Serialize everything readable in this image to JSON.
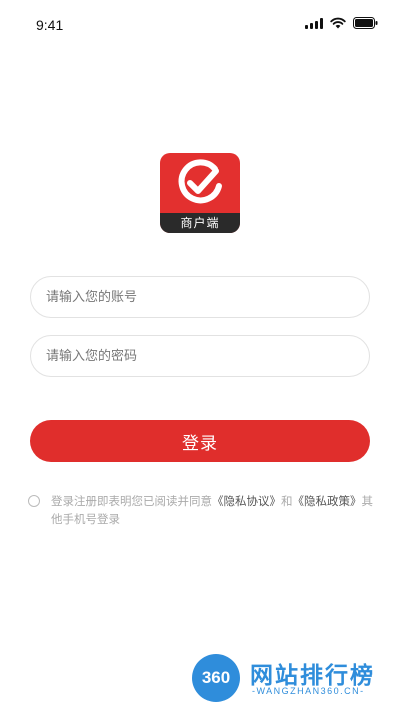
{
  "status_bar": {
    "time": "9:41"
  },
  "logo": {
    "label": "商户端"
  },
  "form": {
    "account_placeholder": "请输入您的账号",
    "password_placeholder": "请输入您的密码",
    "login_label": "登录"
  },
  "agreement": {
    "prefix": "登录注册即表明您已阅读并同意",
    "privacy_agreement": "《隐私协议》",
    "and": "和",
    "privacy_policy": "《隐私政策》",
    "other_login": "其他手机号登录"
  },
  "watermark": {
    "badge": "360",
    "title": "网站排行榜",
    "subtitle": "-WANGZHAN360.CN-"
  },
  "colors": {
    "brand_red": "#e02e2c",
    "dark_band": "#2a2a2a",
    "watermark_blue": "#2f8ddb"
  }
}
